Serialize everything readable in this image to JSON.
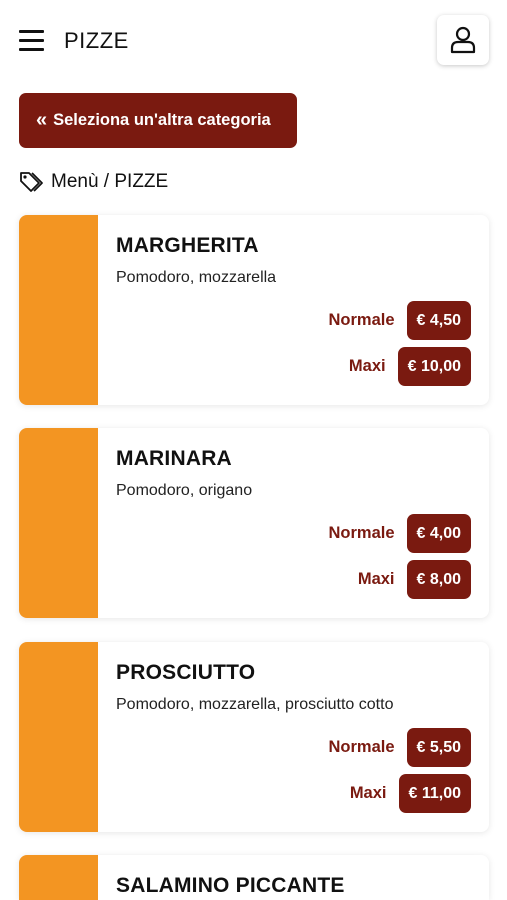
{
  "header": {
    "title": "PIZZE"
  },
  "back_button": {
    "label": "Seleziona un'altra categoria"
  },
  "breadcrumb": {
    "text": "Menù / PIZZE"
  },
  "colors": {
    "accent": "#7a1a10",
    "thumbnail": "#f39522"
  },
  "products": [
    {
      "name": "MARGHERITA",
      "description": "Pomodoro, mozzarella",
      "prices": [
        {
          "label": "Normale",
          "value": "€ 4,50"
        },
        {
          "label": "Maxi",
          "value": "€ 10,00"
        }
      ]
    },
    {
      "name": "MARINARA",
      "description": "Pomodoro, origano",
      "prices": [
        {
          "label": "Normale",
          "value": "€ 4,00"
        },
        {
          "label": "Maxi",
          "value": "€ 8,00"
        }
      ]
    },
    {
      "name": "PROSCIUTTO",
      "description": "Pomodoro, mozzarella, prosciutto cotto",
      "prices": [
        {
          "label": "Normale",
          "value": "€ 5,50"
        },
        {
          "label": "Maxi",
          "value": "€ 11,00"
        }
      ]
    },
    {
      "name": "SALAMINO PICCANTE"
    }
  ]
}
